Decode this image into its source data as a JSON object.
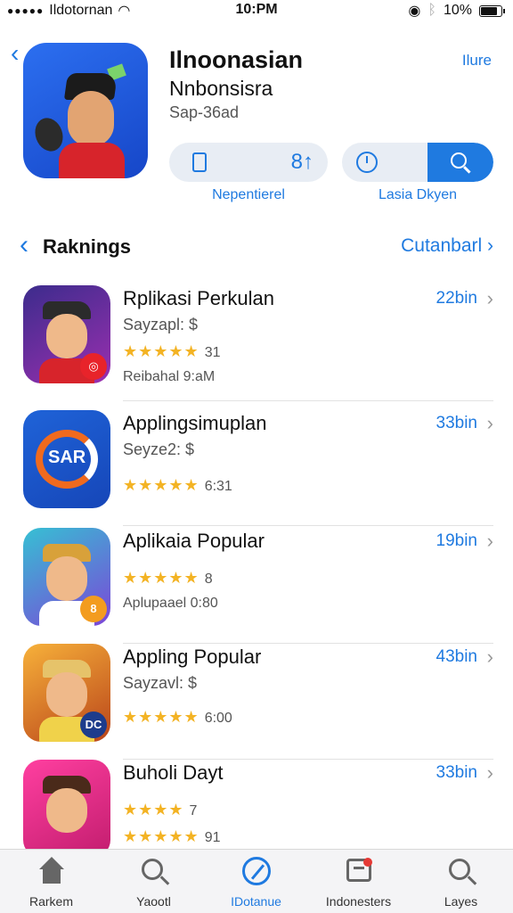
{
  "status_bar": {
    "carrier": "Ildotornan",
    "time": "10:PM",
    "battery": "10%"
  },
  "header": {
    "title": "Ilnoonasian",
    "subtitle": "Nnbonsisra",
    "meta": "Sap-36ad",
    "more_label": "Ilure",
    "stat_value": "8↑",
    "left_action_label": "Nepentierel",
    "right_action_label": "Lasia Dkyen",
    "accent_color": "#1f7ae0"
  },
  "section": {
    "title": "Raknings",
    "more_label": "Cutanbarl"
  },
  "apps": [
    {
      "name": "Rplikasi Perkulan",
      "subline": "Sayzapl: $",
      "stars": "★★★★★",
      "rating": "31",
      "extra": "Reibahal 9:aM",
      "size": "22bin"
    },
    {
      "name": "Applingsimuplan",
      "subline": "Seyze2: $",
      "stars": "★★★★★",
      "rating": "6:31",
      "size": "33bin"
    },
    {
      "name": "Aplikaia Popular",
      "stars": "★★★★★",
      "rating": "8",
      "extra": "Aplupaael 0:80",
      "size": "19bin"
    },
    {
      "name": "Appling Popular",
      "subline": "Sayzavl: $",
      "stars": "★★★★★",
      "rating": "6:00",
      "size": "43bin"
    },
    {
      "name": "Buholi Dayt",
      "stars": "★★★★",
      "rating": "7",
      "stars2": "★★★★★",
      "rating2": "91",
      "size": "33bin"
    }
  ],
  "icon_badges": {
    "app2": "SAR",
    "app3": "8",
    "app4": "DC"
  },
  "tabs": [
    {
      "label": "Rarkem",
      "icon": "home-icon"
    },
    {
      "label": "Yaootl",
      "icon": "search-icon"
    },
    {
      "label": "IDotanue",
      "icon": "compass-icon",
      "active": true
    },
    {
      "label": "Indonesters",
      "icon": "updates-icon"
    },
    {
      "label": "Layes",
      "icon": "search-icon"
    }
  ]
}
